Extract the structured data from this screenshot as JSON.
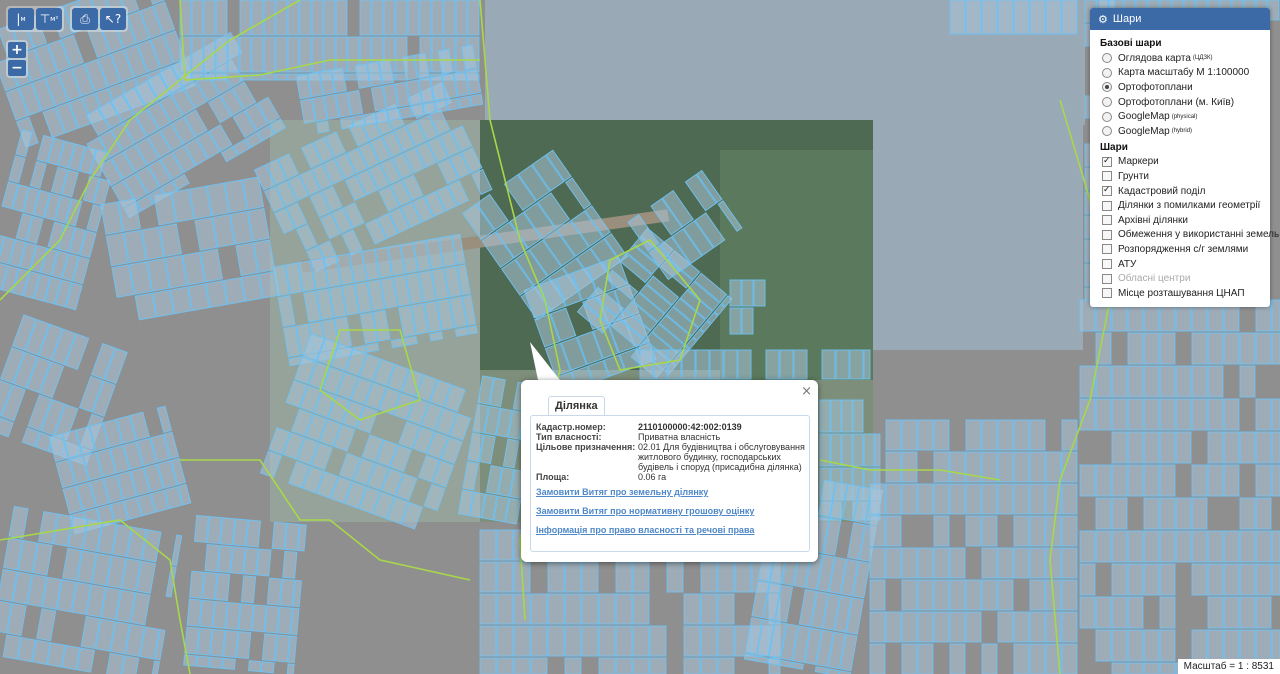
{
  "toolbar": {
    "length_label": "м",
    "area_label": "м²",
    "print_icon": "print-icon",
    "info_icon": "pointer-help-icon"
  },
  "zoom": {
    "in_label": "+",
    "out_label": "−"
  },
  "layers": {
    "title": "Шари",
    "base_title": "Базові шари",
    "base": [
      {
        "label": "Оглядова карта",
        "sup": "(ЦДЗК)",
        "selected": false
      },
      {
        "label": "Карта масштабу М 1:100000",
        "sup": "",
        "selected": false
      },
      {
        "label": "Ортофотоплани",
        "sup": "",
        "selected": true
      },
      {
        "label": "Ортофотоплани (м. Київ)",
        "sup": "",
        "selected": false
      },
      {
        "label": "GoogleMap",
        "sup": "(physical)",
        "selected": false
      },
      {
        "label": "GoogleMap",
        "sup": "(hybrid)",
        "selected": false
      }
    ],
    "overlay_title": "Шари",
    "overlays": [
      {
        "label": "Маркери",
        "checked": true,
        "disabled": false
      },
      {
        "label": "Грунти",
        "checked": false,
        "disabled": false
      },
      {
        "label": "Кадастровий поділ",
        "checked": true,
        "disabled": false
      },
      {
        "label": "Ділянки з помилками геометрії",
        "checked": false,
        "disabled": false
      },
      {
        "label": "Архівні ділянки",
        "checked": false,
        "disabled": false
      },
      {
        "label": "Обмеження у використанні земель",
        "checked": false,
        "disabled": false
      },
      {
        "label": "Розпорядження с/г землями",
        "checked": false,
        "disabled": false
      },
      {
        "label": "АТУ",
        "checked": false,
        "disabled": false
      },
      {
        "label": "Обласні центри",
        "checked": false,
        "disabled": true
      },
      {
        "label": "Місце розташування ЦНАП",
        "checked": false,
        "disabled": false
      }
    ]
  },
  "popup": {
    "close": "×",
    "tab": "Ділянка",
    "fields": [
      {
        "key": "Кадастр.номер:",
        "value": "2110100000:42:002:0139"
      },
      {
        "key": "Тип власності:",
        "value": "Приватна власність"
      },
      {
        "key": "Цільове призначення:",
        "value": "02.01 Для будівництва і обслуговування житлового будинку, господарських будівель і споруд (присадибна ділянка)"
      },
      {
        "key": "Площа:",
        "value": "0.06 га"
      }
    ],
    "links": [
      "Замовити Витяг про земельну ділянку",
      "Замовити Витяг про нормативну грошову оцінку",
      "Інформація про право власності та речові права"
    ]
  },
  "scale": "Масштаб = 1 : 8531",
  "colors": {
    "background": "#8f8f8f",
    "parcel_fill": "#a9c4d9",
    "parcel_stroke": "#6ec3f5",
    "boundary": "#a8d84a",
    "ortho_dark": "#5d7a63",
    "accent": "#3b6aa6"
  }
}
